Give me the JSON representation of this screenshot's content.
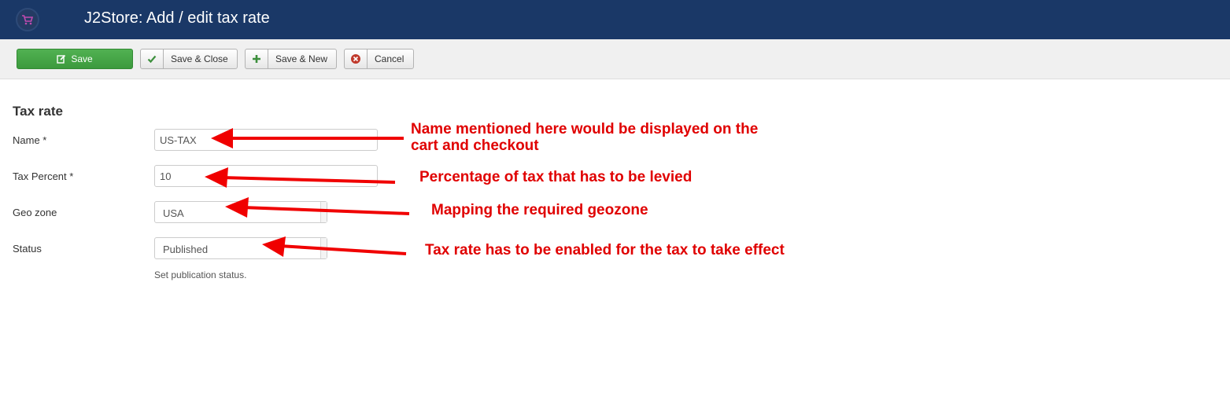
{
  "header": {
    "title": "J2Store: Add / edit tax rate",
    "logo_icon": "cart-logo-icon"
  },
  "toolbar": {
    "save_label": "Save",
    "save_close_label": "Save & Close",
    "save_new_label": "Save & New",
    "cancel_label": "Cancel"
  },
  "form": {
    "section_title": "Tax rate",
    "name": {
      "label": "Name *",
      "value": "US-TAX"
    },
    "tax_percent": {
      "label": "Tax Percent *",
      "value": "10"
    },
    "geo_zone": {
      "label": "Geo zone",
      "value": "USA"
    },
    "status": {
      "label": "Status",
      "value": "Published",
      "help": "Set publication status."
    }
  },
  "annotations": {
    "name_note_line1": "Name mentioned here would be displayed on the",
    "name_note_line2": "cart and checkout",
    "percent_note": "Percentage of tax that has to be levied",
    "geozone_note": "Mapping the required geozone",
    "status_note": "Tax rate has to be enabled for the tax to take effect"
  },
  "colors": {
    "header_bg": "#1a3867",
    "save_green": "#3c9a3d",
    "annotation_red": "#e00000"
  }
}
